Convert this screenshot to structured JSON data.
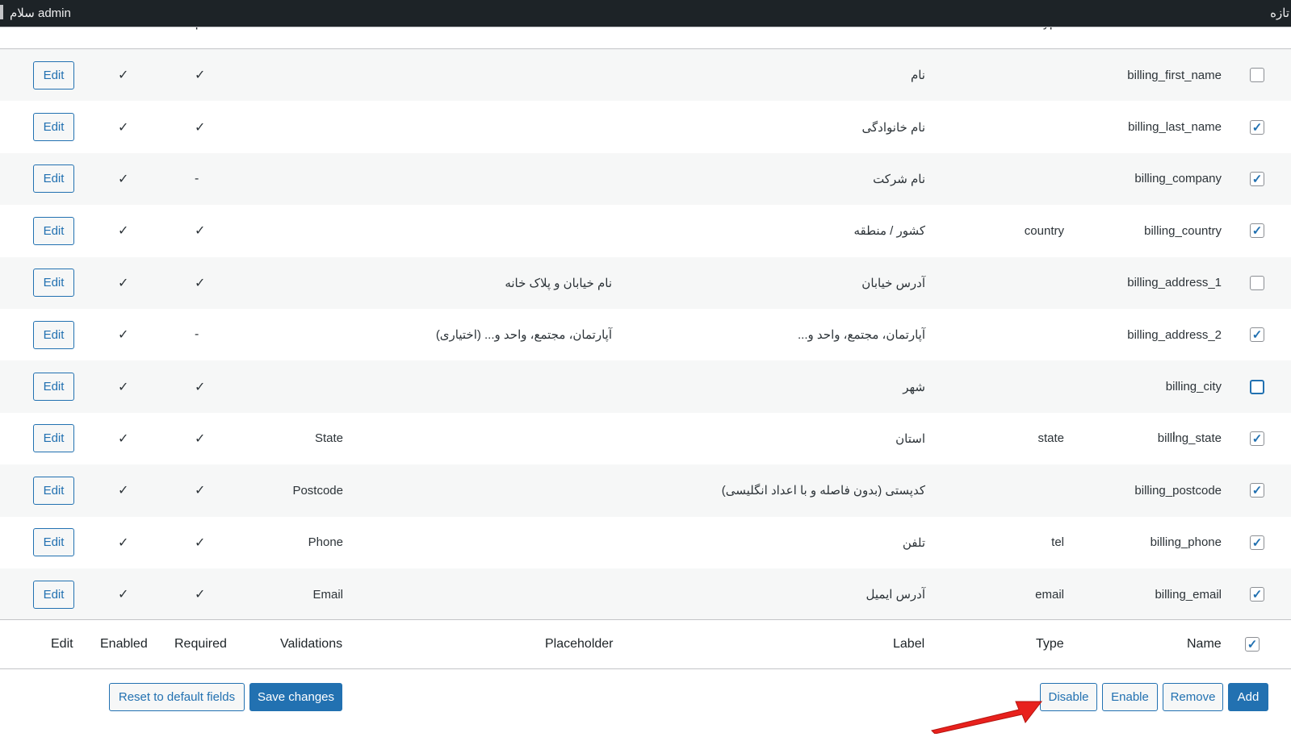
{
  "adminbar": {
    "greeting": "سلام admin",
    "right_text": "تازه"
  },
  "columns": {
    "edit": "Edit",
    "enabled": "Enabled",
    "required": "Required",
    "validations": "Validations",
    "placeholder": "Placeholder",
    "label": "Label",
    "type": "Type",
    "name": "Name"
  },
  "check_mark": "✓",
  "dash": "-",
  "rows": [
    {
      "edit": "Edit",
      "enabled": "✓",
      "required": "✓",
      "validations": "",
      "placeholder": "",
      "label": "نام",
      "type": "",
      "name": "billing_first_name",
      "checked": false
    },
    {
      "edit": "Edit",
      "enabled": "✓",
      "required": "✓",
      "validations": "",
      "placeholder": "",
      "label": "نام خانوادگی",
      "type": "",
      "name": "billing_last_name",
      "checked": true
    },
    {
      "edit": "Edit",
      "enabled": "✓",
      "required": "-",
      "validations": "",
      "placeholder": "",
      "label": "نام شرکت",
      "type": "",
      "name": "billing_company",
      "checked": true
    },
    {
      "edit": "Edit",
      "enabled": "✓",
      "required": "✓",
      "validations": "",
      "placeholder": "",
      "label": "کشور / منطقه",
      "type": "country",
      "name": "billing_country",
      "checked": true
    },
    {
      "edit": "Edit",
      "enabled": "✓",
      "required": "✓",
      "validations": "",
      "placeholder": "نام خیابان و پلاک خانه",
      "label": "آدرس خیابان",
      "type": "",
      "name": "billing_address_1",
      "checked": false
    },
    {
      "edit": "Edit",
      "enabled": "✓",
      "required": "-",
      "validations": "",
      "placeholder": "آپارتمان، مجتمع، واحد و... (اختیاری)",
      "label": "آپارتمان، مجتمع، واحد و...",
      "type": "",
      "name": "billing_address_2",
      "checked": true
    },
    {
      "edit": "Edit",
      "enabled": "✓",
      "required": "✓",
      "validations": "",
      "placeholder": "",
      "label": "شهر",
      "type": "",
      "name": "billing_city",
      "checked": false
    },
    {
      "edit": "Edit",
      "enabled": "✓",
      "required": "✓",
      "validations": "State",
      "placeholder": "",
      "label": "استان",
      "type": "state",
      "name": "billing_state",
      "checked": true
    },
    {
      "edit": "Edit",
      "enabled": "✓",
      "required": "✓",
      "validations": "Postcode",
      "placeholder": "",
      "label": "کدپستی (بدون فاصله و با اعداد انگلیسی)",
      "type": "",
      "name": "billing_postcode",
      "checked": true
    },
    {
      "edit": "Edit",
      "enabled": "✓",
      "required": "✓",
      "validations": "Phone",
      "placeholder": "",
      "label": "تلفن",
      "type": "tel",
      "name": "billing_phone",
      "checked": true
    },
    {
      "edit": "Edit",
      "enabled": "✓",
      "required": "✓",
      "validations": "Email",
      "placeholder": "",
      "label": "آدرس ایمیل",
      "type": "email",
      "name": "billing_email",
      "checked": true
    }
  ],
  "footer_checked": true,
  "actions": {
    "reset": "Reset to default fields",
    "save": "Save changes",
    "disable": "Disable",
    "enable": "Enable",
    "remove": "Remove",
    "add": "Add"
  },
  "colors": {
    "accent": "#2271b1",
    "adminbar": "#1d2327",
    "arrow": "#e8211d"
  }
}
